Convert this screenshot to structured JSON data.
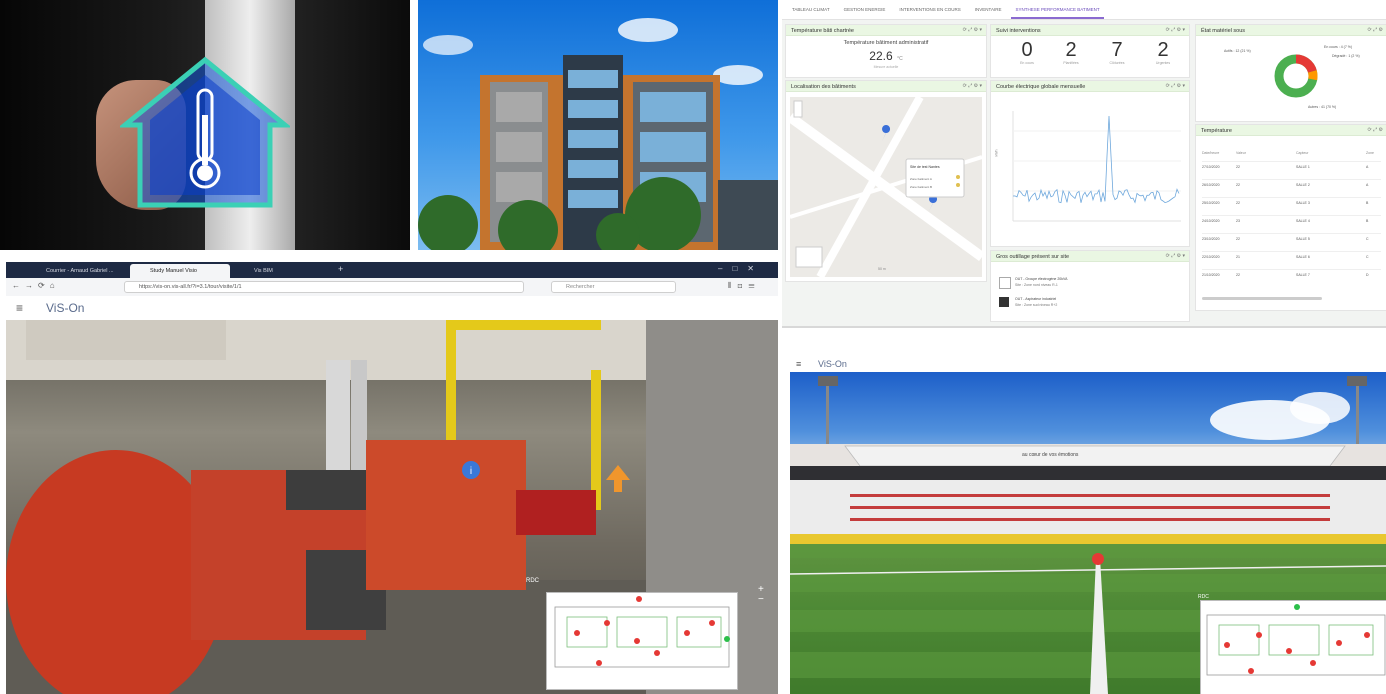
{
  "dashboard": {
    "tabs": [
      "TABLEAU CLIMAT",
      "GESTION ENERGIE",
      "INTERVENTIONS EN COURS",
      "INVENTAIRE",
      "SYNTHESE PERFORMANCE BATIMENT"
    ],
    "active_tab": 4,
    "cards": {
      "temperature": {
        "title": "Température bâti chartrée",
        "subtitle": "Température bâtiment administratif",
        "value": "22.6",
        "unit": "°C",
        "caption": "Mesure actuelle"
      },
      "interventions": {
        "title": "Suivi interventions",
        "kpis": [
          {
            "value": "0",
            "label": "En cours"
          },
          {
            "value": "2",
            "label": "Planifiées"
          },
          {
            "value": "7",
            "label": "Clôturées"
          },
          {
            "value": "2",
            "label": "Urgentes"
          }
        ]
      },
      "materiel": {
        "title": "État matériel sous",
        "donut_labels": [
          "Actifs : 12 (21 %)",
          "En cours : 4 (7 %)",
          "Dégradé : 1 (2 %)",
          "Autres : 41 (70 %)"
        ]
      },
      "localisation": {
        "title": "Localisation des bâtiments",
        "popup_title": "Site de test Nantes",
        "popup_lines": [
          "Zone batiment A",
          "Zone batiment B"
        ],
        "scale": "50 m"
      },
      "courbe": {
        "title": "Courbe électrique globale mensuelle",
        "ylabel": "kWh"
      },
      "outillage": {
        "title": "Gros outillage présent sur site",
        "items": [
          {
            "line1": "OUT - Groupe électrogène 20kVA",
            "line2": "Site : Zone nord niveau R-1"
          },
          {
            "line1": "OUT - Aspirateur industriel",
            "line2": "Site : Zone sud niveau R+2"
          }
        ]
      },
      "temperature_table": {
        "title": "Température",
        "headers": [
          "Date/heure",
          "Valeur",
          "Capteur",
          "Zone"
        ],
        "rows": [
          [
            "27/10/2020",
            "22",
            "SALLE 1",
            "A"
          ],
          [
            "26/10/2020",
            "22",
            "SALLE 2",
            "A"
          ],
          [
            "25/10/2020",
            "22",
            "SALLE 3",
            "B"
          ],
          [
            "24/10/2020",
            "23",
            "SALLE 4",
            "B"
          ],
          [
            "23/10/2020",
            "22",
            "SALLE 5",
            "C"
          ],
          [
            "22/10/2020",
            "21",
            "SALLE 6",
            "C"
          ],
          [
            "21/10/2020",
            "22",
            "SALLE 7",
            "D"
          ]
        ]
      }
    }
  },
  "browser": {
    "tabs": [
      "Courrier - Arnaud Gabriel ...",
      "Study Manuel Visio",
      "Vis BIM"
    ],
    "active_tab": 1,
    "url": "https://vis-on.vis-all.fr/?i=3.1/tour/visite/1/1",
    "search_placeholder": "Rechercher",
    "app_name": "ViS-On",
    "minimap_label": "RDC"
  },
  "stadium": {
    "app_name": "ViS-On",
    "banner": "au cœur de vos émotions",
    "minimap_label": "RDC"
  },
  "colors": {
    "dash_header": "#eaf7e3",
    "accent_purple": "#8a6ad0",
    "chart_line": "#6fa8dc",
    "donut_green": "#4caf50",
    "donut_red": "#e53935",
    "donut_orange": "#ff9800",
    "browser_dark": "#1e2a44",
    "vis_on_logo": "#5a6b8c"
  }
}
